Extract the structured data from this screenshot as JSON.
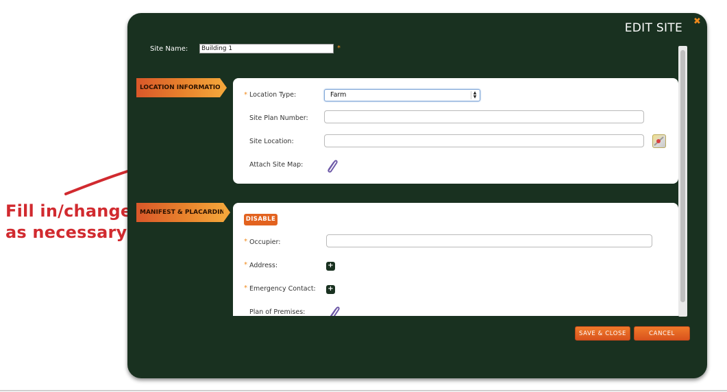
{
  "annotation": {
    "line1": "Fill in/change",
    "line2": "as necessary",
    "color": "#d12a2f"
  },
  "dialog": {
    "title": "EDIT SITE",
    "close_glyph": "✖",
    "site_name": {
      "label": "Site Name:",
      "value": "Building 1",
      "required": "*"
    }
  },
  "location_section": {
    "tag": "LOCATION INFORMATION",
    "location_type": {
      "label": "Location Type:",
      "value": "Farm",
      "required": "*"
    },
    "site_plan_number": {
      "label": "Site Plan Number:",
      "value": ""
    },
    "site_location": {
      "label": "Site Location:",
      "value": ""
    },
    "attach_site_map": {
      "label": "Attach Site Map:"
    }
  },
  "manifest_section": {
    "tag": "MANIFEST & PLACARDING",
    "disable_label": "DISABLE",
    "occupier": {
      "label": "Occupier:",
      "value": "",
      "required": "*"
    },
    "address": {
      "label": "Address:",
      "required": "*",
      "add_glyph": "+"
    },
    "emergency_contact": {
      "label": "Emergency Contact:",
      "required": "*",
      "add_glyph": "+"
    },
    "plan_of_premises": {
      "label": "Plan of Premises:"
    }
  },
  "actions": {
    "save_close": "SAVE & CLOSE",
    "cancel": "CANCEL"
  },
  "colors": {
    "modal_bg": "#193120",
    "accent_orange": "#e2621f",
    "required_star": "#f08a1c"
  }
}
